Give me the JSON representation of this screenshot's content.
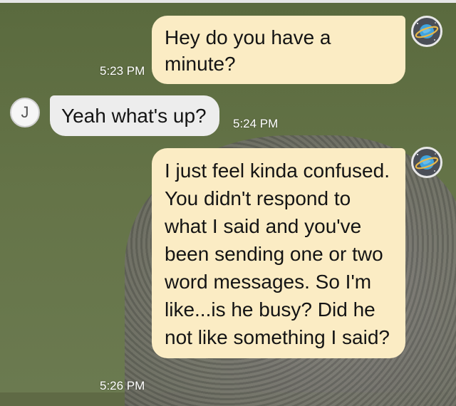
{
  "messages": [
    {
      "sender": "me",
      "text": "Hey do you have a minute?",
      "time": "5:23 PM"
    },
    {
      "sender": "J",
      "avatar_letter": "J",
      "text": "Yeah what's up?",
      "time": "5:24 PM"
    },
    {
      "sender": "me",
      "text": "I just feel kinda confused. You didn't respond to what I said and you've been sending one or two word messages. So I'm like...is he busy? Did he not like something I said?",
      "time": "5:26 PM"
    }
  ],
  "icons": {
    "my_avatar": "planet-icon"
  },
  "colors": {
    "outgoing_bubble": "#fbecc4",
    "incoming_bubble": "#ededed",
    "timestamp": "#ffffff"
  }
}
